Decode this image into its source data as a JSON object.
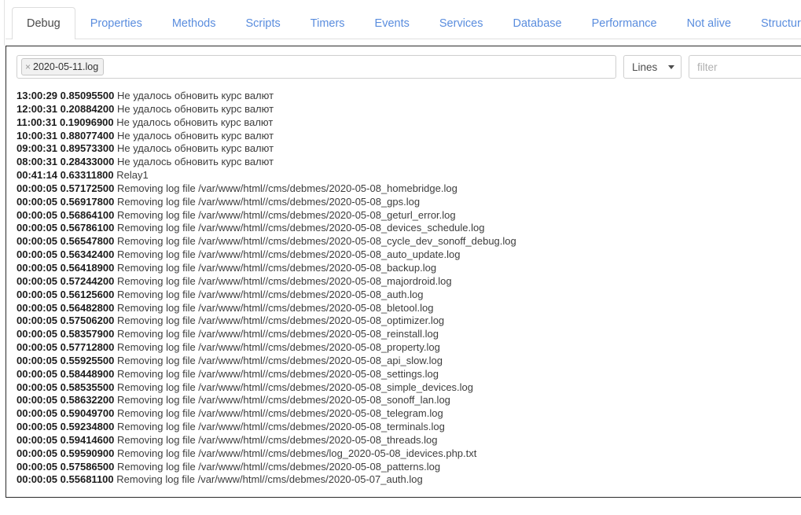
{
  "tabs": [
    {
      "label": "Debug",
      "active": true
    },
    {
      "label": "Properties",
      "active": false
    },
    {
      "label": "Methods",
      "active": false
    },
    {
      "label": "Scripts",
      "active": false
    },
    {
      "label": "Timers",
      "active": false
    },
    {
      "label": "Events",
      "active": false
    },
    {
      "label": "Services",
      "active": false
    },
    {
      "label": "Database",
      "active": false
    },
    {
      "label": "Performance",
      "active": false
    },
    {
      "label": "Not alive",
      "active": false
    },
    {
      "label": "Structure",
      "active": false
    }
  ],
  "toolbar": {
    "tag": {
      "remove_icon": "×",
      "label": "2020-05-11.log"
    },
    "lines_select": {
      "value": "Lines",
      "caret_icon": "chevron-down-icon"
    },
    "filter": {
      "value": "",
      "placeholder": "filter"
    }
  },
  "colors": {
    "tab_link": "#5a8dde",
    "tab_active_text": "#4a4a4a",
    "panel_border": "#2b2b2b",
    "log_text": "#3d3d3d",
    "log_bold": "#1c1c1c"
  },
  "log_lines": [
    {
      "time": "13:00:29",
      "duration": "0.85095500",
      "message": "Не удалось обновить курс валют"
    },
    {
      "time": "12:00:31",
      "duration": "0.20884200",
      "message": "Не удалось обновить курс валют"
    },
    {
      "time": "11:00:31",
      "duration": "0.19096900",
      "message": "Не удалось обновить курс валют"
    },
    {
      "time": "10:00:31",
      "duration": "0.88077400",
      "message": "Не удалось обновить курс валют"
    },
    {
      "time": "09:00:31",
      "duration": "0.89573300",
      "message": "Не удалось обновить курс валют"
    },
    {
      "time": "08:00:31",
      "duration": "0.28433000",
      "message": "Не удалось обновить курс валют"
    },
    {
      "time": "00:41:14",
      "duration": "0.63311800",
      "message": "Relay1"
    },
    {
      "time": "00:00:05",
      "duration": "0.57172500",
      "message": "Removing log file /var/www/html//cms/debmes/2020-05-08_homebridge.log"
    },
    {
      "time": "00:00:05",
      "duration": "0.56917800",
      "message": "Removing log file /var/www/html//cms/debmes/2020-05-08_gps.log"
    },
    {
      "time": "00:00:05",
      "duration": "0.56864100",
      "message": "Removing log file /var/www/html//cms/debmes/2020-05-08_geturl_error.log"
    },
    {
      "time": "00:00:05",
      "duration": "0.56786100",
      "message": "Removing log file /var/www/html//cms/debmes/2020-05-08_devices_schedule.log"
    },
    {
      "time": "00:00:05",
      "duration": "0.56547800",
      "message": "Removing log file /var/www/html//cms/debmes/2020-05-08_cycle_dev_sonoff_debug.log"
    },
    {
      "time": "00:00:05",
      "duration": "0.56342400",
      "message": "Removing log file /var/www/html//cms/debmes/2020-05-08_auto_update.log"
    },
    {
      "time": "00:00:05",
      "duration": "0.56418900",
      "message": "Removing log file /var/www/html//cms/debmes/2020-05-08_backup.log"
    },
    {
      "time": "00:00:05",
      "duration": "0.57244200",
      "message": "Removing log file /var/www/html//cms/debmes/2020-05-08_majordroid.log"
    },
    {
      "time": "00:00:05",
      "duration": "0.56125600",
      "message": "Removing log file /var/www/html//cms/debmes/2020-05-08_auth.log"
    },
    {
      "time": "00:00:05",
      "duration": "0.56482800",
      "message": "Removing log file /var/www/html//cms/debmes/2020-05-08_bletool.log"
    },
    {
      "time": "00:00:05",
      "duration": "0.57506200",
      "message": "Removing log file /var/www/html//cms/debmes/2020-05-08_optimizer.log"
    },
    {
      "time": "00:00:05",
      "duration": "0.58357900",
      "message": "Removing log file /var/www/html//cms/debmes/2020-05-08_reinstall.log"
    },
    {
      "time": "00:00:05",
      "duration": "0.57712800",
      "message": "Removing log file /var/www/html//cms/debmes/2020-05-08_property.log"
    },
    {
      "time": "00:00:05",
      "duration": "0.55925500",
      "message": "Removing log file /var/www/html//cms/debmes/2020-05-08_api_slow.log"
    },
    {
      "time": "00:00:05",
      "duration": "0.58448900",
      "message": "Removing log file /var/www/html//cms/debmes/2020-05-08_settings.log"
    },
    {
      "time": "00:00:05",
      "duration": "0.58535500",
      "message": "Removing log file /var/www/html//cms/debmes/2020-05-08_simple_devices.log"
    },
    {
      "time": "00:00:05",
      "duration": "0.58632200",
      "message": "Removing log file /var/www/html//cms/debmes/2020-05-08_sonoff_lan.log"
    },
    {
      "time": "00:00:05",
      "duration": "0.59049700",
      "message": "Removing log file /var/www/html//cms/debmes/2020-05-08_telegram.log"
    },
    {
      "time": "00:00:05",
      "duration": "0.59234800",
      "message": "Removing log file /var/www/html//cms/debmes/2020-05-08_terminals.log"
    },
    {
      "time": "00:00:05",
      "duration": "0.59414600",
      "message": "Removing log file /var/www/html//cms/debmes/2020-05-08_threads.log"
    },
    {
      "time": "00:00:05",
      "duration": "0.59590900",
      "message": "Removing log file /var/www/html//cms/debmes/log_2020-05-08_idevices.php.txt"
    },
    {
      "time": "00:00:05",
      "duration": "0.57586500",
      "message": "Removing log file /var/www/html//cms/debmes/2020-05-08_patterns.log"
    },
    {
      "time": "00:00:05",
      "duration": "0.55681100",
      "message": "Removing log file /var/www/html//cms/debmes/2020-05-07_auth.log"
    }
  ]
}
